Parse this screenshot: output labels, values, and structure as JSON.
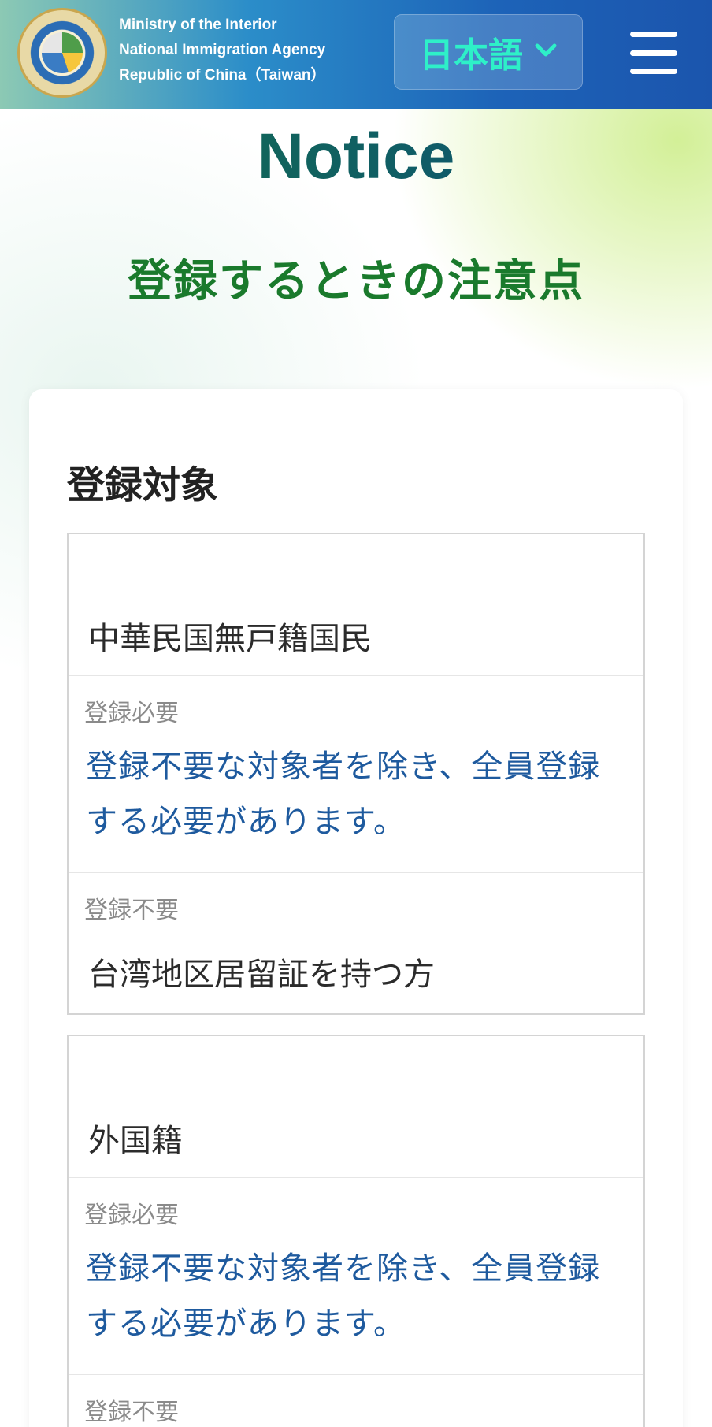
{
  "header": {
    "agency_lines": [
      "Ministry of the Interior",
      "National Immigration Agency",
      "Republic of China（Taiwan）"
    ],
    "language_label": "日本語",
    "logo_name": "national-immigration-agency-seal",
    "menu_icon": "hamburger-menu-icon"
  },
  "page": {
    "title": "Notice",
    "subtitle": "登録するときの注意点"
  },
  "card": {
    "title": "登録対象",
    "groups": [
      {
        "name": "中華民国無戸籍国民",
        "required_label": "登録必要",
        "required_text": "登録不要な対象者を除き、全員登録する必要があります。",
        "not_required_label": "登録不要",
        "not_required_text": "台湾地区居留証を持つ方"
      },
      {
        "name": "外国籍",
        "required_label": "登録必要",
        "required_text": "登録不要な対象者を除き、全員登録する必要があります。",
        "not_required_label": "登録不要"
      }
    ]
  },
  "colors": {
    "header_blue": "#1d63b8",
    "accent_green": "#1a7a2c",
    "link_blue": "#1e5a9e",
    "language_text": "#2ef0c8"
  }
}
